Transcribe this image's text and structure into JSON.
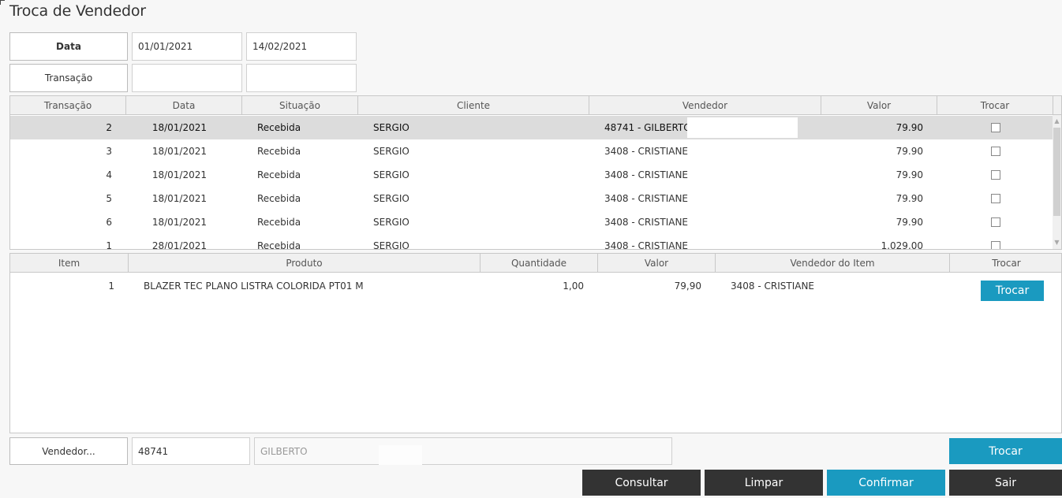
{
  "page": {
    "title": "Troca de Vendedor"
  },
  "filters": {
    "data_label": "Data",
    "data_from": "01/01/2021",
    "data_to": "14/02/2021",
    "transacao_label": "Transação",
    "transacao_from": "",
    "transacao_to": ""
  },
  "transactions": {
    "columns": [
      "Transação",
      "Data",
      "Situação",
      "Cliente",
      "Vendedor",
      "Valor",
      "Trocar"
    ],
    "rows": [
      {
        "transacao": "2",
        "data": "18/01/2021",
        "situacao": "Recebida",
        "cliente": "SERGIO",
        "vendedor": "48741 - GILBERTO I",
        "valor": "79.90",
        "trocar": false
      },
      {
        "transacao": "3",
        "data": "18/01/2021",
        "situacao": "Recebida",
        "cliente": "SERGIO",
        "vendedor": "3408 - CRISTIANE",
        "valor": "79.90",
        "trocar": false
      },
      {
        "transacao": "4",
        "data": "18/01/2021",
        "situacao": "Recebida",
        "cliente": "SERGIO",
        "vendedor": "3408 - CRISTIANE",
        "valor": "79.90",
        "trocar": false
      },
      {
        "transacao": "5",
        "data": "18/01/2021",
        "situacao": "Recebida",
        "cliente": "SERGIO",
        "vendedor": "3408 - CRISTIANE",
        "valor": "79.90",
        "trocar": false
      },
      {
        "transacao": "6",
        "data": "18/01/2021",
        "situacao": "Recebida",
        "cliente": "SERGIO",
        "vendedor": "3408 - CRISTIANE",
        "valor": "79.90",
        "trocar": false
      },
      {
        "transacao": "1",
        "data": "28/01/2021",
        "situacao": "Recebida",
        "cliente": "SERGIO",
        "vendedor": "3408 - CRISTIANE",
        "valor": "1.029,00",
        "trocar": false
      }
    ]
  },
  "items": {
    "columns": [
      "Item",
      "Produto",
      "Quantidade",
      "Valor",
      "Vendedor do Item",
      "Trocar"
    ],
    "rows": [
      {
        "item": "1",
        "produto": "BLAZER TEC PLANO LISTRA COLORIDA PT01 M",
        "quantidade": "1,00",
        "valor": "79,90",
        "vendedor": "3408 - CRISTIANE",
        "trocar_label": "Trocar"
      }
    ]
  },
  "vendedor": {
    "label": "Vendedor...",
    "code": "48741",
    "name": "GILBERTO"
  },
  "buttons": {
    "trocar": "Trocar",
    "consultar": "Consultar",
    "limpar": "Limpar",
    "confirmar": "Confirmar",
    "sair": "Sair"
  },
  "colors": {
    "accent": "#1a9ac0",
    "dark_button": "#333333",
    "selected_row": "#dcdcdc"
  }
}
